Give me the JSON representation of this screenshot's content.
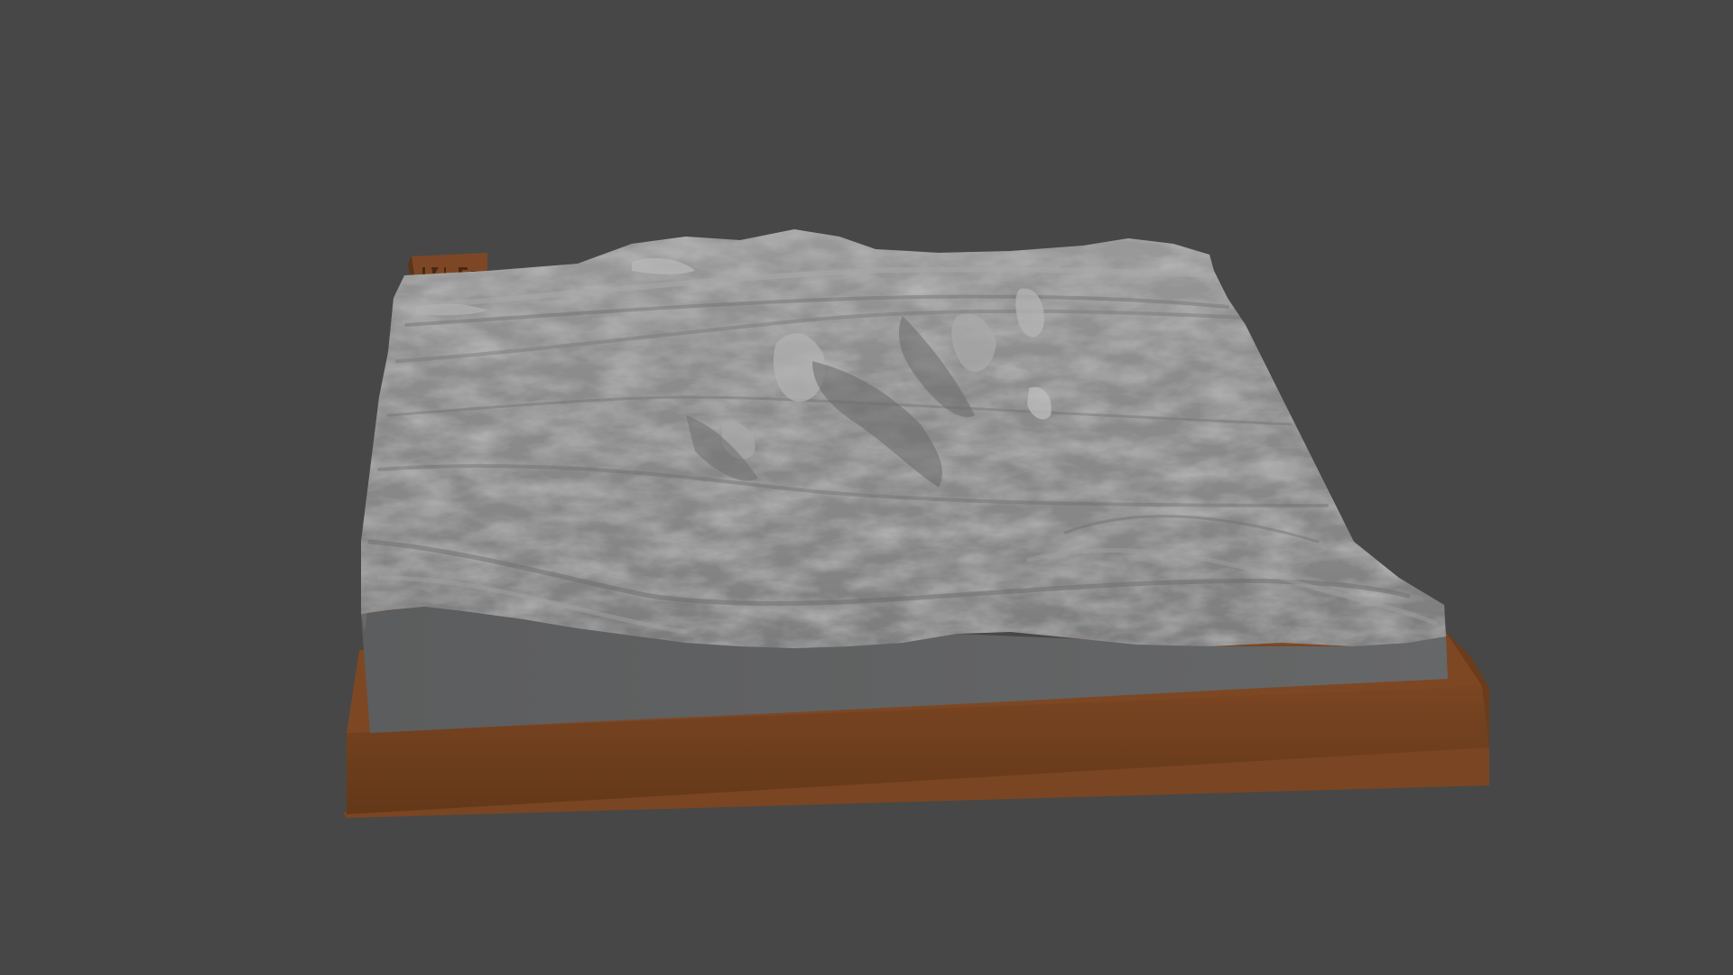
{
  "viewport": {
    "background_color": "#474747"
  },
  "model": {
    "terrain_color": "#8a8a8a",
    "terrain_side_color": "#636465",
    "base_color": "#6e3f1f",
    "base_top_color": "#7a4622",
    "label_plate_color": "#7a4524",
    "label_plate_marks": "engraved-logo"
  }
}
